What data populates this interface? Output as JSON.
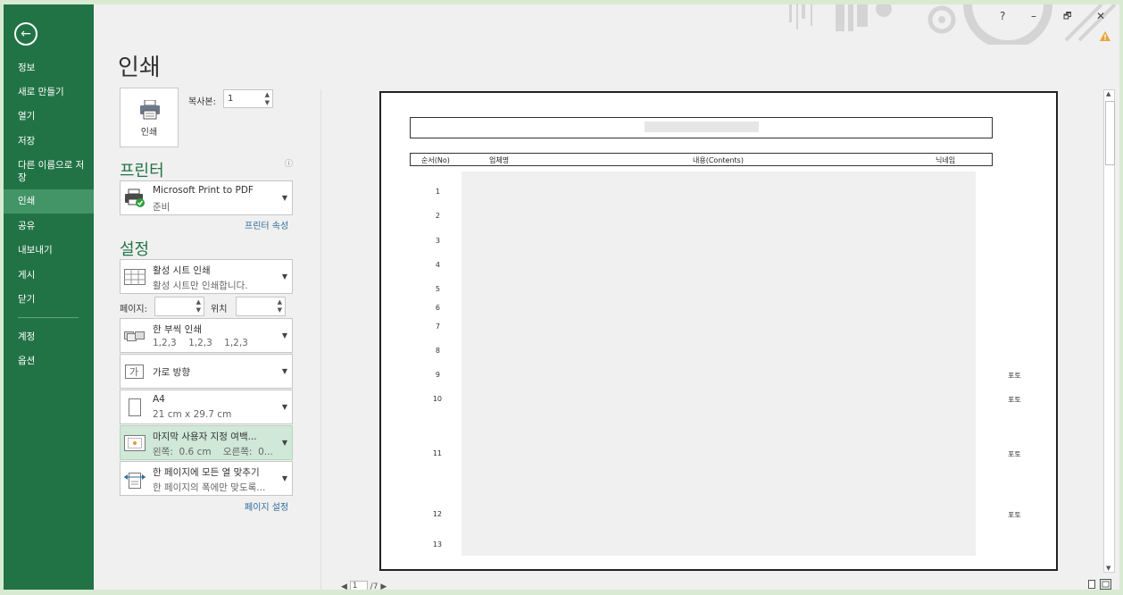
{
  "sidebar": {
    "items": [
      {
        "label": "정보"
      },
      {
        "label": "새로 만들기"
      },
      {
        "label": "열기"
      },
      {
        "label": "저장"
      },
      {
        "label": "다른 이름으로 저장"
      },
      {
        "label": "인쇄",
        "active": true
      },
      {
        "label": "공유"
      },
      {
        "label": "내보내기"
      },
      {
        "label": "게시"
      },
      {
        "label": "닫기"
      }
    ],
    "bottom_items": [
      {
        "label": "계정"
      },
      {
        "label": "옵션"
      }
    ]
  },
  "window": {
    "help": "?",
    "minimize": "–",
    "restore": "🗗",
    "close": "✕"
  },
  "page_title": "인쇄",
  "print_button": {
    "label": "인쇄"
  },
  "copies": {
    "label": "복사본:",
    "value": "1"
  },
  "printer": {
    "heading": "프린터",
    "name": "Microsoft Print to PDF",
    "status": "준비",
    "properties_link": "프린터 속성"
  },
  "settings": {
    "heading": "설정",
    "what": {
      "title": "활성 시트 인쇄",
      "subtitle": "활성 시트만 인쇄합니다."
    },
    "pages_label": "페이지:",
    "pages_from": "",
    "to_label": "위치",
    "pages_to": "",
    "collate": {
      "title": "한 부씩 인쇄",
      "subtitle": "1,2,3    1,2,3    1,2,3"
    },
    "orientation": {
      "title": "가로 방향"
    },
    "paper": {
      "title": "A4",
      "subtitle": "21 cm x 29.7 cm"
    },
    "margins": {
      "title": "마지막 사용자 지정 여백...",
      "subtitle": "왼쪽:  0.6 cm    오른쪽:  0..."
    },
    "scaling": {
      "title": "한 페이지에 모든 열 맞추기",
      "subtitle": "한 페이지의 폭에만 맞도록..."
    },
    "page_setup_link": "페이지 설정"
  },
  "preview": {
    "headers": {
      "no": "순서(No)",
      "company": "업체명",
      "contents": "내용(Contents)",
      "nickname": "닉네임"
    },
    "rows": [
      "1",
      "2",
      "3",
      "4",
      "5",
      "6",
      "7",
      "8",
      "9",
      "10",
      "11",
      "12",
      "13"
    ],
    "photo_label": "포토",
    "photo_rows": [
      "9",
      "10",
      "11",
      "12"
    ]
  },
  "pager": {
    "current": "1",
    "total": "/7"
  }
}
